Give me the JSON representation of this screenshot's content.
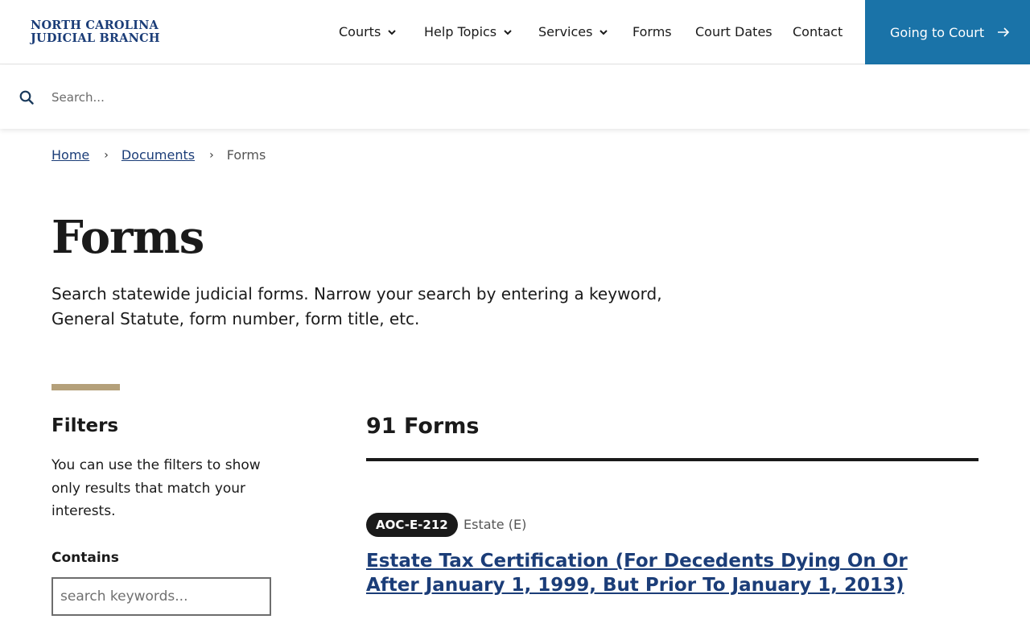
{
  "header": {
    "logo_line1": "NORTH CAROLINA",
    "logo_line2": "JUDICIAL BRANCH",
    "nav": [
      {
        "label": "Courts"
      },
      {
        "label": "Help Topics"
      },
      {
        "label": "Services"
      },
      {
        "label": "Forms"
      },
      {
        "label": "Court Dates"
      },
      {
        "label": "Contact"
      }
    ],
    "cta_label": "Going to Court",
    "cta_color": "#1a73a8",
    "brand_color": "#1b3d78"
  },
  "search": {
    "placeholder": "Search...",
    "value": ""
  },
  "breadcrumb": {
    "home": "Home",
    "documents": "Documents",
    "current": "Forms"
  },
  "page": {
    "title": "Forms",
    "intro": "Search statewide judicial forms. Narrow your search by entering a keyword, General Statute, form number, form title, etc."
  },
  "filters": {
    "title": "Filters",
    "description": "You can use the filters to show only results that match your interests.",
    "contains_label": "Contains",
    "keyword_placeholder": "search keywords...",
    "accent_color": "#b4a07a"
  },
  "results": {
    "count_label": "91 Forms",
    "items": [
      {
        "code": "AOC-E-212",
        "category": "Estate (E)",
        "title": "Estate Tax Certification (For Decedents Dying On Or After January 1, 1999, But Prior To January 1, 2013)"
      }
    ]
  }
}
